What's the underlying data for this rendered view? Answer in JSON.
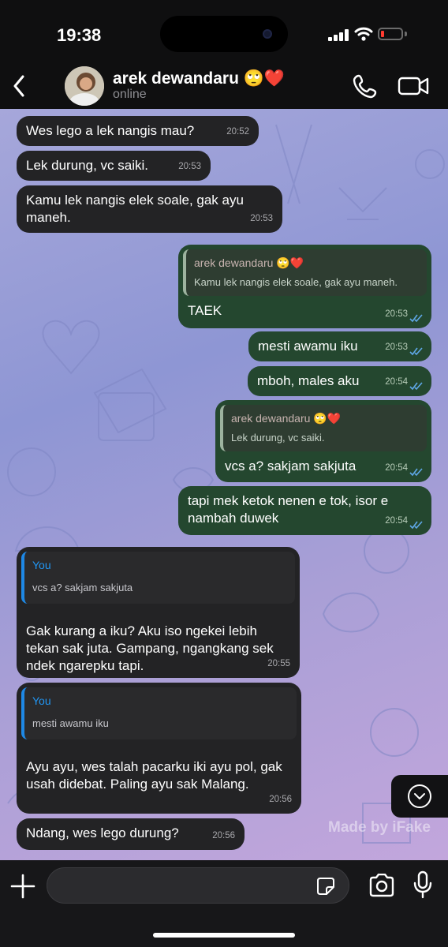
{
  "status_bar": {
    "time": "19:38"
  },
  "header": {
    "contact_name": "arek dewandaru 🙄❤️",
    "contact_status": "online"
  },
  "messages": [
    {
      "direction": "in",
      "text": "Wes lego a lek nangis mau?",
      "time": "20:52"
    },
    {
      "direction": "in",
      "text": "Lek durung, vc saiki.",
      "time": "20:53"
    },
    {
      "direction": "in",
      "text": "Kamu lek nangis elek soale, gak ayu maneh.",
      "time": "20:53"
    },
    {
      "direction": "out",
      "reply_to": {
        "name": "arek dewandaru 🙄❤️",
        "text": "Kamu lek nangis elek soale, gak ayu maneh."
      },
      "text": "TAEK",
      "time": "20:53"
    },
    {
      "direction": "out",
      "text": "mesti awamu iku",
      "time": "20:53"
    },
    {
      "direction": "out",
      "text": "mboh, males aku",
      "time": "20:54"
    },
    {
      "direction": "out",
      "reply_to": {
        "name": "arek dewandaru 🙄❤️",
        "text": "Lek durung, vc saiki."
      },
      "text": "vcs a? sakjam sakjuta",
      "time": "20:54"
    },
    {
      "direction": "out",
      "text": "tapi mek ketok nenen e tok, isor e nambah duwek",
      "time": "20:54"
    },
    {
      "direction": "in",
      "reply_to": {
        "name": "You",
        "text": "vcs a? sakjam sakjuta"
      },
      "text": "Gak kurang a iku? Aku iso ngekei lebih tekan sak juta. Gampang, ngangkang sek ndek ngarepku tapi.",
      "time": "20:55"
    },
    {
      "direction": "in",
      "reply_to": {
        "name": "You",
        "text": "mesti awamu iku"
      },
      "text": "Ayu ayu, wes talah pacarku iki ayu pol, gak usah didebat. Paling ayu sak Malang.",
      "time": "20:56"
    },
    {
      "direction": "in",
      "text": "Ndang, wes lego durung?",
      "time": "20:56"
    }
  ],
  "watermark": "Made by iFake",
  "input": {
    "placeholder": ""
  },
  "colors": {
    "incoming_bubble": "#232325",
    "outgoing_bubble": "#24472f",
    "read_check": "#5fa8e8",
    "reply_accent": "#1e88e5"
  }
}
